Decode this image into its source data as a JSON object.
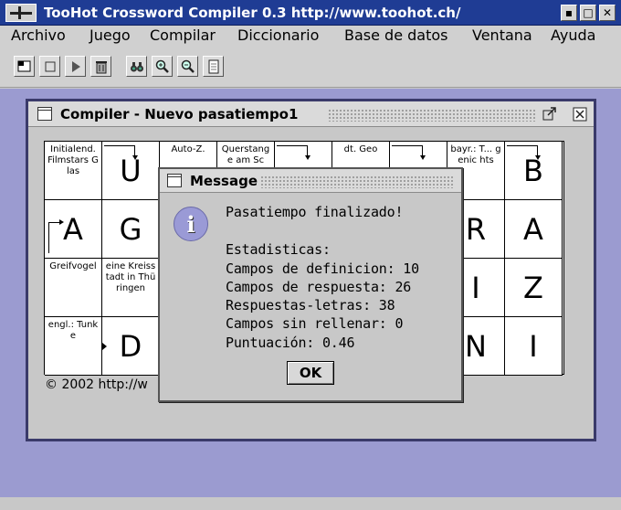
{
  "window": {
    "title": "TooHot Crossword Compiler 0.3 http://www.toohot.ch/",
    "buttons": {
      "minimize": "▪",
      "maximize": "□",
      "close": "✕"
    }
  },
  "menu": [
    "Archivo",
    "Juego",
    "Compilar",
    "Diccionario",
    "Base de datos",
    "Ventana",
    "Ayuda"
  ],
  "toolbar": [
    "new-icon",
    "stop-icon",
    "play-icon",
    "trash-icon",
    "binoculars-icon",
    "zoom-in-icon",
    "zoom-out-icon",
    "document-icon"
  ],
  "frame": {
    "title": "Compiler - Nuevo pasatiempo1",
    "copyright": "© 2002 http://w"
  },
  "grid": [
    [
      {
        "t": "def",
        "v": "Initialend. Filmstars Glas"
      },
      {
        "t": "let",
        "v": "U",
        "arrow": "down"
      },
      {
        "t": "def",
        "v": "Auto-Z."
      },
      {
        "t": "def",
        "v": "Querstange am Sc"
      },
      {
        "t": "let",
        "v": "",
        "arrow": "down"
      },
      {
        "t": "def",
        "v": "dt. Geo"
      },
      {
        "t": "let",
        "v": "",
        "arrow": "down"
      },
      {
        "t": "def",
        "v": "bayr.: T... genic hts"
      },
      {
        "t": "let",
        "v": "B",
        "arrow": "down"
      }
    ],
    [
      {
        "t": "let",
        "v": "A",
        "arrow": "right"
      },
      {
        "t": "let",
        "v": "G"
      },
      {
        "t": "let",
        "v": ""
      },
      {
        "t": "let",
        "v": ""
      },
      {
        "t": "let",
        "v": ""
      },
      {
        "t": "let",
        "v": ""
      },
      {
        "t": "let",
        "v": ""
      },
      {
        "t": "let",
        "v": "R"
      },
      {
        "t": "let",
        "v": "A"
      }
    ],
    [
      {
        "t": "def",
        "v": "Greifvogel"
      },
      {
        "t": "def",
        "v": "eine Kreisstadt in Thüringen"
      },
      {
        "t": "let",
        "v": ""
      },
      {
        "t": "let",
        "v": ""
      },
      {
        "t": "let",
        "v": ""
      },
      {
        "t": "let",
        "v": ""
      },
      {
        "t": "let",
        "v": ""
      },
      {
        "t": "let",
        "v": "I"
      },
      {
        "t": "let",
        "v": "Z"
      }
    ],
    [
      {
        "t": "def",
        "v": "engl.: Tunke"
      },
      {
        "t": "let",
        "v": "D",
        "arrow": "small"
      },
      {
        "t": "let",
        "v": ""
      },
      {
        "t": "let",
        "v": ""
      },
      {
        "t": "let",
        "v": ""
      },
      {
        "t": "let",
        "v": ""
      },
      {
        "t": "let",
        "v": ""
      },
      {
        "t": "let",
        "v": "N"
      },
      {
        "t": "let",
        "v": "I"
      }
    ]
  ],
  "dialog": {
    "title": "Message",
    "icon": "info-icon",
    "heading": "Pasatiempo finalizado!",
    "stats_label": "Estadisticas:",
    "lines": [
      "Campos de definicion: 10",
      "Campos de respuesta: 26",
      "Respuestas-letras: 38",
      "Campos sin rellenar: 0",
      "Puntuación: 0.46"
    ],
    "ok_label": "OK"
  }
}
